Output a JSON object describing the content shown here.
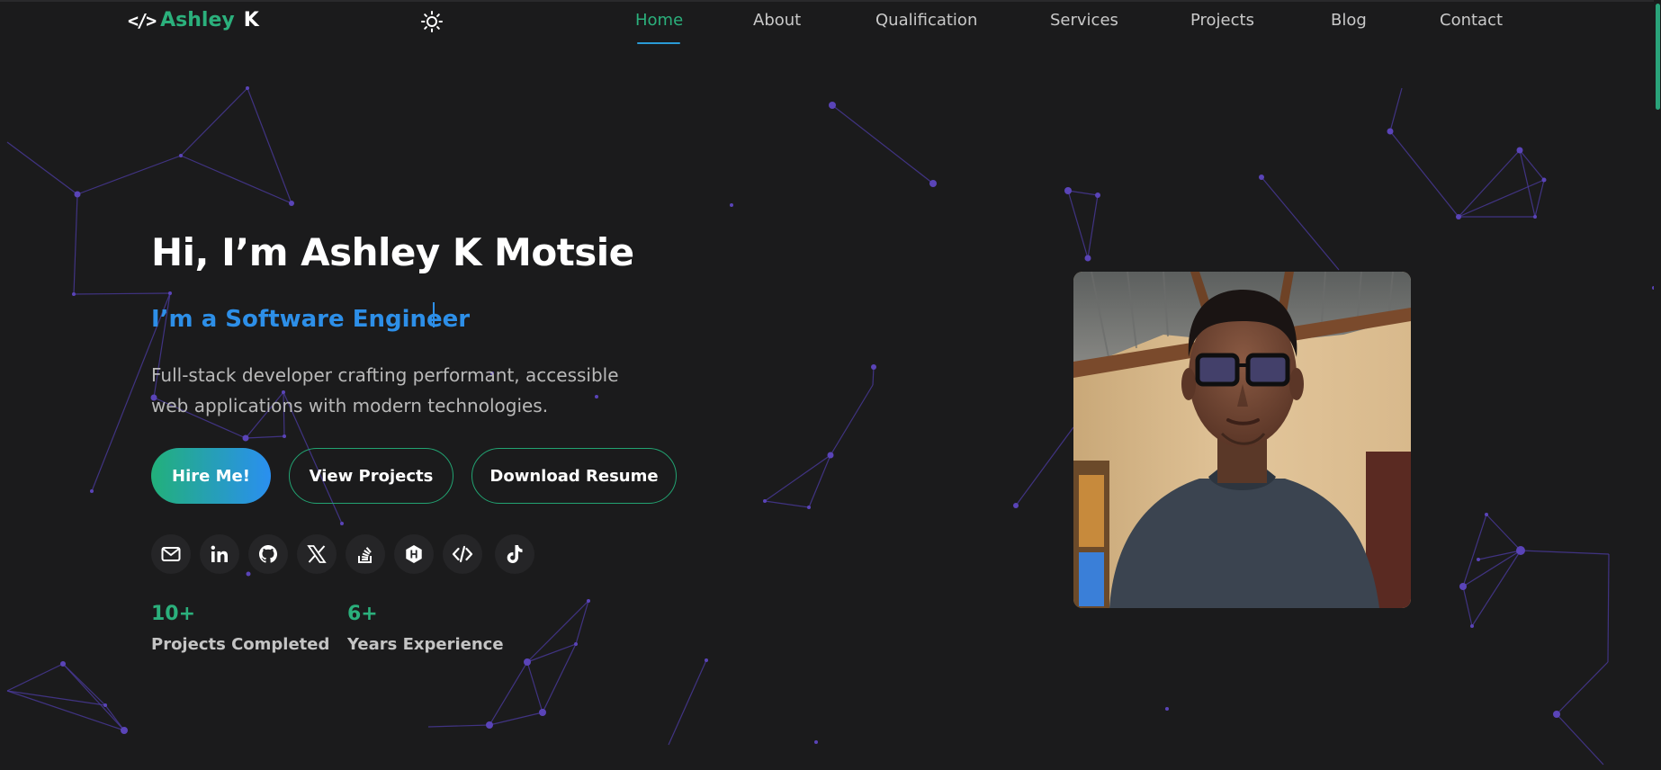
{
  "nav": {
    "logo_first": "Ashley",
    "logo_last": "K",
    "links": [
      {
        "label": "Home",
        "active": true
      },
      {
        "label": "About",
        "active": false
      },
      {
        "label": "Qualification",
        "active": false
      },
      {
        "label": "Services",
        "active": false
      },
      {
        "label": "Projects",
        "active": false
      },
      {
        "label": "Blog",
        "active": false
      },
      {
        "label": "Contact",
        "active": false
      }
    ],
    "theme_icon": "sun-icon"
  },
  "hero": {
    "title": "Hi, I’m Ashley K Motsie",
    "role": "I’m a Software Engineer",
    "description": "Full-stack developer crafting performant, accessible web applications with modern technologies.",
    "buttons": {
      "hire": "Hire Me!",
      "projects": "View Projects",
      "resume": "Download Resume"
    },
    "socials": [
      "mail-icon",
      "linkedin-icon",
      "github-icon",
      "x-icon",
      "stackoverflow-icon",
      "hackerrank-icon",
      "code-icon",
      "tiktok-icon"
    ],
    "stats": [
      {
        "value": "10+",
        "label": "Projects Completed"
      },
      {
        "value": "6+",
        "label": "Years Experience"
      }
    ]
  },
  "colors": {
    "accent_green": "#2bb07c",
    "accent_blue": "#2d8fe8",
    "background": "#1b1b1c",
    "network": "#4a3a9c"
  }
}
